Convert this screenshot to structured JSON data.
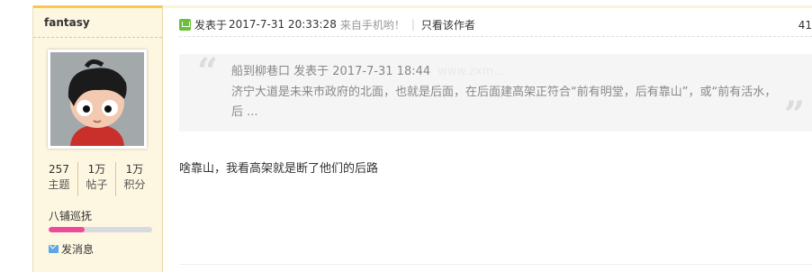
{
  "author": {
    "username": "fantasy",
    "stats": [
      {
        "value": "257",
        "label": "主题"
      },
      {
        "value": "1万",
        "label": "帖子"
      },
      {
        "value": "1万",
        "label": "积分"
      }
    ],
    "rank": "八铺巡抚",
    "rank_progress": 0.35,
    "message_label": "发消息"
  },
  "post": {
    "posted_label": "发表于",
    "posted_date": "2017-7-31 20:33:28",
    "mobile_label": "来自手机哟！",
    "separator": "|",
    "author_only_label": "只看该作者",
    "floor": "41",
    "quote": {
      "meta": "船到柳巷口 发表于 2017-7-31 18:44",
      "watermark": "www.zxm...",
      "body": "济宁大道是未来市政府的北面，也就是后面，在后面建高架正符合“前有明堂，后有靠山”，或“前有活水，后 ..."
    },
    "reply_text": "啥靠山，我看高架就是断了他们的后路"
  },
  "colors": {
    "sidebar_bg": "#fdf6e0",
    "sidebar_band": "#f7c94e",
    "rank_bar_fill": "#ee4a9b",
    "post_icon": "#6bbf3a",
    "quote_bg": "#f5f5f5"
  },
  "icons": {
    "post": "post-status-icon",
    "message": "envelope-icon",
    "avatar": "cartoon-avatar"
  }
}
